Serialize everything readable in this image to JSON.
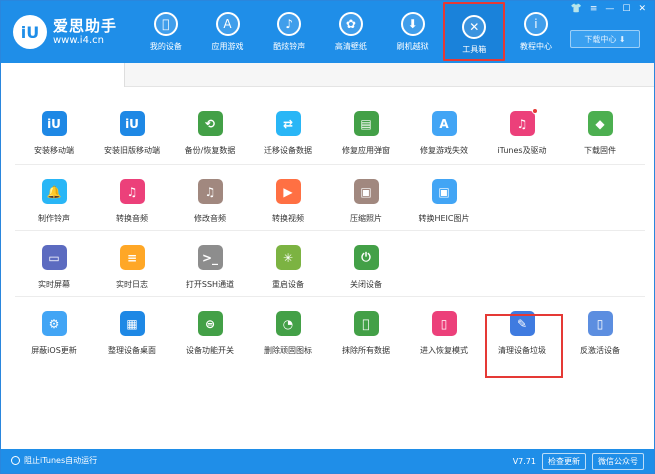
{
  "app": {
    "name": "爱思助手",
    "url": "www.i4.cn",
    "logo_letters": "iU"
  },
  "nav": [
    {
      "label": "我的设备",
      "glyph": ""
    },
    {
      "label": "应用游戏",
      "glyph": "A"
    },
    {
      "label": "酷炫铃声",
      "glyph": "♪"
    },
    {
      "label": "高清壁纸",
      "glyph": "✿"
    },
    {
      "label": "刷机越狱",
      "glyph": "⬇"
    },
    {
      "label": "工具箱",
      "glyph": "✕"
    },
    {
      "label": "教程中心",
      "glyph": "i"
    }
  ],
  "download_label": "下载中心 ⬇",
  "window_controls": [
    "👕",
    "≡",
    "—",
    "☐",
    "✕"
  ],
  "tools": [
    [
      {
        "label": "安装移动端",
        "glyph": "iU",
        "color": "#1e88e5"
      },
      {
        "label": "安装旧版移动端",
        "glyph": "iU",
        "color": "#1e88e5"
      },
      {
        "label": "备份/恢复数据",
        "glyph": "⟲",
        "color": "#43a047"
      },
      {
        "label": "迁移设备数据",
        "glyph": "⇄",
        "color": "#29b6f6"
      },
      {
        "label": "修复应用弹窗",
        "glyph": "▤",
        "color": "#43a047"
      },
      {
        "label": "修复游戏失效",
        "glyph": "A",
        "color": "#42a5f5"
      },
      {
        "label": "iTunes及驱动",
        "glyph": "♫",
        "color": "#ec407a",
        "badge": true
      },
      {
        "label": "下载固件",
        "glyph": "◆",
        "color": "#4caf50"
      }
    ],
    [
      {
        "label": "制作铃声",
        "glyph": "🔔",
        "color": "#29b6f6"
      },
      {
        "label": "转换音频",
        "glyph": "♫",
        "color": "#ec407a"
      },
      {
        "label": "修改音频",
        "glyph": "♫",
        "color": "#a1887f"
      },
      {
        "label": "转换视频",
        "glyph": "▶",
        "color": "#ff7043"
      },
      {
        "label": "压缩照片",
        "glyph": "▣",
        "color": "#a1887f"
      },
      {
        "label": "转换HEIC图片",
        "glyph": "▣",
        "color": "#42a5f5"
      }
    ],
    [
      {
        "label": "实时屏幕",
        "glyph": "▭",
        "color": "#5c6bc0"
      },
      {
        "label": "实时日志",
        "glyph": "≡",
        "color": "#ffa726"
      },
      {
        "label": "打开SSH通道",
        "glyph": ">_",
        "color": "#8d8d8d"
      },
      {
        "label": "重启设备",
        "glyph": "✳",
        "color": "#7cb342"
      },
      {
        "label": "关闭设备",
        "glyph": "⏻",
        "color": "#43a047"
      }
    ],
    [
      {
        "label": "屏蔽iOS更新",
        "glyph": "⚙",
        "color": "#42a5f5"
      },
      {
        "label": "整理设备桌面",
        "glyph": "▦",
        "color": "#1e88e5"
      },
      {
        "label": "设备功能开关",
        "glyph": "⊜",
        "color": "#43a047"
      },
      {
        "label": "删除顽固图标",
        "glyph": "◔",
        "color": "#43a047"
      },
      {
        "label": "抹除所有数据",
        "glyph": "",
        "color": "#43a047"
      },
      {
        "label": "进入恢复模式",
        "glyph": "▯",
        "color": "#ec407a"
      },
      {
        "label": "清理设备垃圾",
        "glyph": "✎",
        "color": "#3f7be0"
      },
      {
        "label": "反激活设备",
        "glyph": "▯",
        "color": "#5c8ee0"
      }
    ]
  ],
  "footer": {
    "left_label": "阻止iTunes自动运行",
    "version": "V7.71",
    "check_update": "检查更新",
    "wechat": "微信公众号"
  }
}
